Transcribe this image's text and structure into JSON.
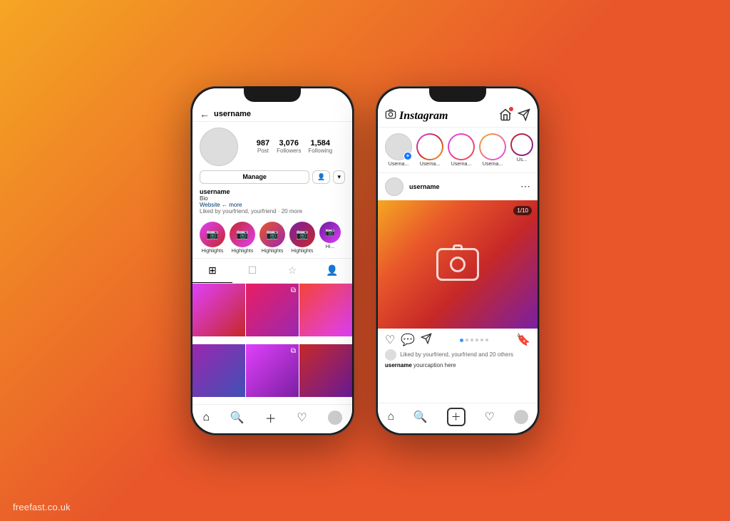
{
  "background": {
    "gradient_start": "#f5a623",
    "gradient_end": "#e8562a"
  },
  "watermark": {
    "text": "freefast.co.uk"
  },
  "left_phone": {
    "header": {
      "back_label": "←",
      "username": "username"
    },
    "stats": {
      "posts_count": "987",
      "posts_label": "Post",
      "followers_count": "3,076",
      "followers_label": "Followers",
      "following_count": "1,584",
      "following_label": "Following"
    },
    "actions": {
      "manage_label": "Manage",
      "person_icon": "👤",
      "chevron_icon": "▾"
    },
    "bio": {
      "username": "username",
      "bio_text": "Bio",
      "website": "Website ← more",
      "liked_by": "Liked by yourfriend, yourfriend · 20 more"
    },
    "highlights": [
      {
        "label": "Highlights"
      },
      {
        "label": "Highlights"
      },
      {
        "label": "Highlights"
      },
      {
        "label": "Highlights"
      },
      {
        "label": "Hi..."
      }
    ],
    "tabs": [
      "⊞",
      "☐",
      "☆",
      "👤"
    ],
    "grid_cells": 6,
    "bottom_nav": {
      "home": "⌂",
      "search": "🔍",
      "add": "+",
      "heart": "♡",
      "profile": "●"
    }
  },
  "right_phone": {
    "header": {
      "logo": "Instagram",
      "activity_icon": "activity",
      "send_icon": "send"
    },
    "stories": [
      {
        "label": "Userna...",
        "type": "your"
      },
      {
        "label": "Userna...",
        "type": "story"
      },
      {
        "label": "Userna...",
        "type": "story"
      },
      {
        "label": "Userna...",
        "type": "story"
      },
      {
        "label": "Us...",
        "type": "story"
      }
    ],
    "post": {
      "username": "username",
      "counter": "1/10",
      "camera_placeholder": "camera",
      "caption_username": "username",
      "caption_text": "yourcaption here",
      "likes_text": "Liked by yourfriend, yourfriend and 20 others"
    },
    "bottom_nav": {
      "home": "⌂",
      "search": "🔍",
      "add": "+",
      "heart": "♡",
      "profile": "●"
    }
  }
}
